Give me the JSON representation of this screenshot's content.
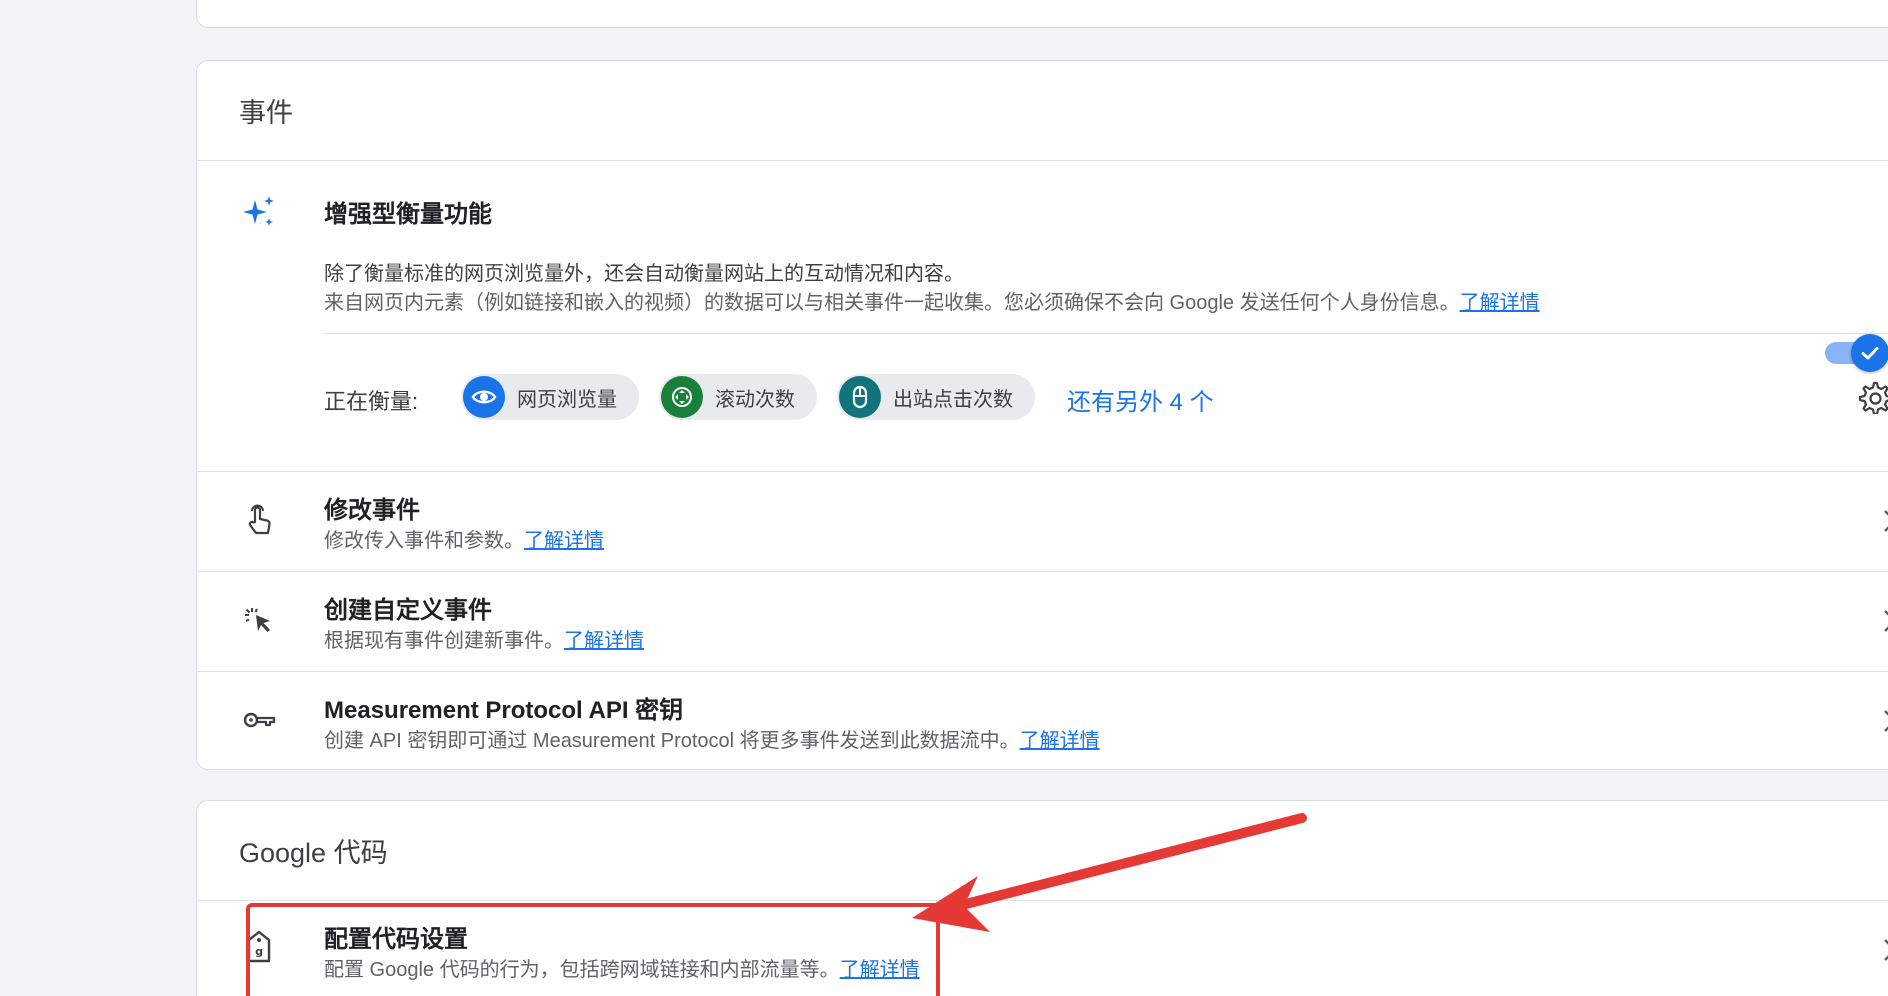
{
  "events_card": {
    "title": "事件",
    "enhanced_measurement": {
      "title": "增强型衡量功能",
      "desc_line1": "除了衡量标准的网页浏览量外，还会自动衡量网站上的互动情况和内容。",
      "desc_line2": "来自网页内元素（例如链接和嵌入的视频）的数据可以与相关事件一起收集。您必须确保不会向 Google 发送任何个人身份信息。",
      "learn_more": "了解详情",
      "toggle_on": true,
      "measuring_label": "正在衡量:",
      "chips": [
        {
          "label": "网页浏览量",
          "icon": "eye-icon",
          "color": "#1a73e8"
        },
        {
          "label": "滚动次数",
          "icon": "scroll-arrows-icon",
          "color": "#188038"
        },
        {
          "label": "出站点击次数",
          "icon": "mouse-icon",
          "color": "#12737d"
        }
      ],
      "more_link": "还有另外 4 个"
    },
    "rows": [
      {
        "title": "修改事件",
        "desc": "修改传入事件和参数。",
        "learn_more": "了解详情",
        "icon": "touch-hand-icon"
      },
      {
        "title": "创建自定义事件",
        "desc": "根据现有事件创建新事件。",
        "learn_more": "了解详情",
        "icon": "sparkle-cursor-icon"
      },
      {
        "title": "Measurement Protocol API 密钥",
        "desc": "创建 API 密钥即可通过 Measurement Protocol 将更多事件发送到此数据流中。",
        "learn_more": "了解详情",
        "icon": "key-icon"
      }
    ]
  },
  "gtag_card": {
    "title": "Google 代码",
    "row": {
      "title": "配置代码设置",
      "desc": "配置 Google 代码的行为，包括跨网域链接和内部流量等。",
      "learn_more": "了解详情",
      "icon": "tag-icon"
    }
  },
  "colors": {
    "accent": "#1a73e8",
    "annotation": "#e53935"
  }
}
